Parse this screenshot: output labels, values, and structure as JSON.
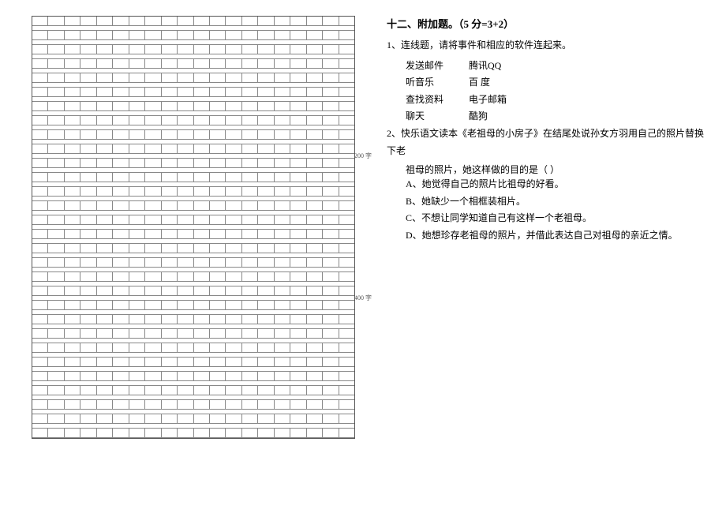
{
  "grid": {
    "columns": 20,
    "markers": [
      {
        "after_row_group": 1,
        "label": "200 字"
      },
      {
        "after_row_group": 2,
        "label": "400 字"
      }
    ]
  },
  "section": {
    "number": "十二、",
    "title": "附加题。",
    "scoring": "（5 分=3+2）"
  },
  "questions": [
    {
      "number": "1、",
      "text": "连线题，请将事件和相应的软件连起来。",
      "matches": [
        {
          "left": "发送邮件",
          "right": "腾讯QQ"
        },
        {
          "left": "听音乐",
          "right": "百  度"
        },
        {
          "left": "查找资料",
          "right": "电子邮箱"
        },
        {
          "left": "聊天",
          "right": "酷狗"
        }
      ]
    },
    {
      "number": "2、",
      "text_line1": "快乐语文读本《老祖母的小房子》在结尾处说孙女方羽用自己的照片替换下老",
      "text_line2": "祖母的照片，她这样做的目的是（        ）",
      "options": [
        {
          "label": "A、",
          "text": "她觉得自己的照片比祖母的好看。"
        },
        {
          "label": "B、",
          "text": "她缺少一个相框装相片。"
        },
        {
          "label": "C、",
          "text": "不想让同学知道自己有这样一个老祖母。"
        },
        {
          "label": "D、",
          "text": "她想珍存老祖母的照片，并借此表达自己对祖母的亲近之情。"
        }
      ]
    }
  ]
}
